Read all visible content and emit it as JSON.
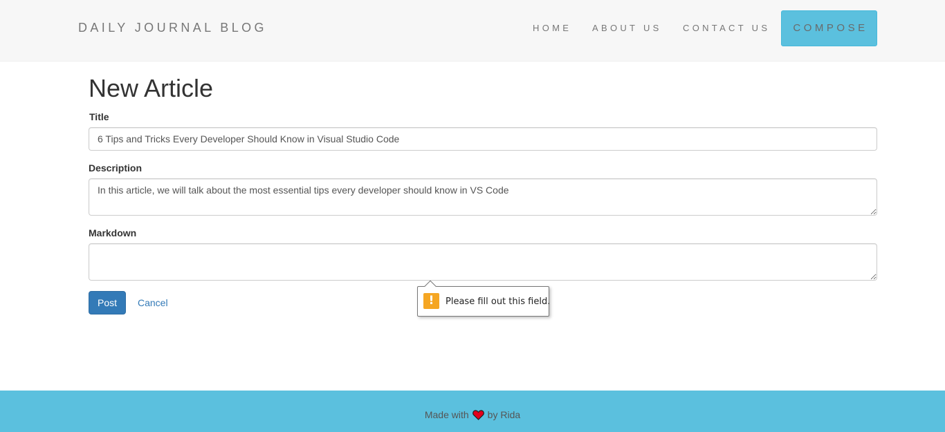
{
  "navbar": {
    "brand": "DAILY JOURNAL BLOG",
    "links": [
      "HOME",
      "ABOUT US",
      "CONTACT US"
    ],
    "compose_label": "COMPOSE"
  },
  "form": {
    "heading": "New Article",
    "title_label": "Title",
    "title_value": "6 Tips and Tricks Every Developer Should Know in Visual Studio Code",
    "description_label": "Description",
    "description_value": "In this article, we will talk about the most essential tips every developer should know in VS Code",
    "markdown_label": "Markdown",
    "markdown_value": "",
    "post_label": "Post",
    "cancel_label": "Cancel"
  },
  "validation_tooltip": {
    "icon": "warning-icon",
    "message": "Please fill out this field."
  },
  "footer": {
    "prefix": "Made with",
    "icon": "heart-icon",
    "suffix": "by Rida"
  },
  "colors": {
    "accent": "#5bc0de",
    "primary_button": "#337ab7",
    "heart": "#e3001b",
    "warning": "#f5a623"
  }
}
